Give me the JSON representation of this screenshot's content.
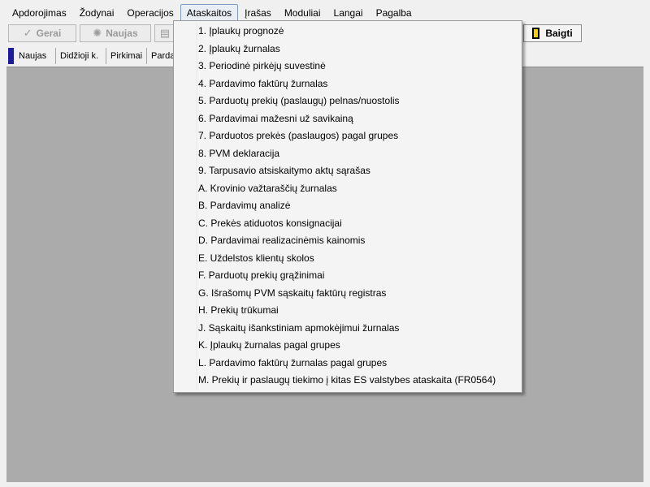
{
  "menubar": {
    "items": [
      "Apdorojimas",
      "Žodynai",
      "Operacijos",
      "Ataskaitos",
      "Įrašas",
      "Moduliai",
      "Langai",
      "Pagalba"
    ],
    "active": "Ataskaitos"
  },
  "toolbar": {
    "gerai_label": "Gerai",
    "naujas_label": "Naujas",
    "baigti_label": "Baigti"
  },
  "tabs": {
    "items": [
      "Naujas",
      "Didžioji k.",
      "Pirkimai",
      "Parda"
    ]
  },
  "dropdown": {
    "items": [
      "1. Įplaukų prognozė",
      "2. Įplaukų žurnalas",
      "3. Periodinė pirkėjų suvestinė",
      "4. Pardavimo faktūrų žurnalas",
      "5. Parduotų prekių (paslaugų) pelnas/nuostolis",
      "6. Pardavimai mažesni už savikainą",
      "7. Parduotos prekės (paslaugos) pagal grupes",
      "8. PVM deklaracija",
      "9. Tarpusavio atsiskaitymo aktų sąrašas",
      "A. Krovinio važtaraščių žurnalas",
      "B. Pardavimų analizė",
      "C. Prekės atiduotos konsignacijai",
      "D. Pardavimai realizacinėmis kainomis",
      "E. Uždelstos klientų skolos",
      "F. Parduotų prekių grąžinimai",
      "G. Išrašomų PVM sąskaitų faktūrų registras",
      "H. Prekių trūkumai",
      "J. Sąskaitų išankstiniam apmokėjimui žurnalas",
      "K. Įplaukų žurnalas pagal grupes",
      "L. Pardavimo faktūrų žurnalas pagal grupes",
      "M. Prekių ir paslaugų tiekimo į kitas ES valstybes ataskaita (FR0564)"
    ]
  },
  "colors": {
    "workspace": "#ababab",
    "tab_marker": "#1c1c9a",
    "baigti_icon": "#f5d000"
  }
}
